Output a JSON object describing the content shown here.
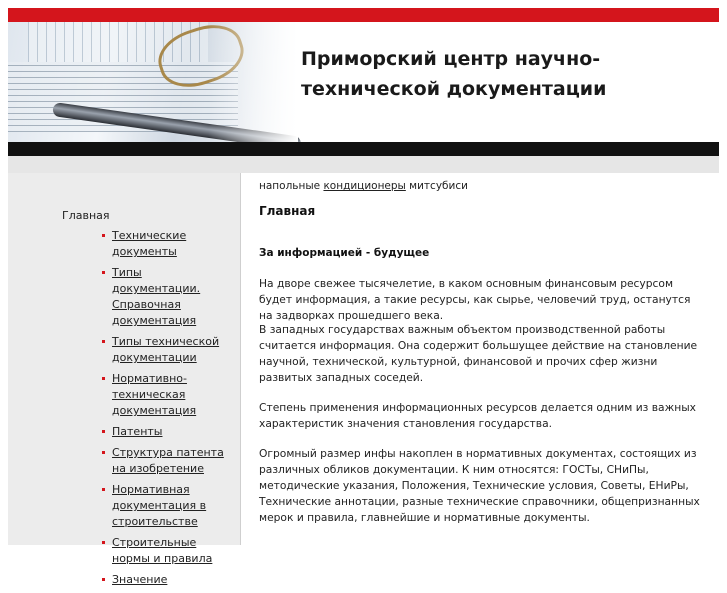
{
  "header": {
    "title_line1": "Приморский центр научно-",
    "title_line2": "технической документации"
  },
  "colors": {
    "accent": "#d4151c",
    "dark_bar": "#111111",
    "sidebar_bg": "#ececec"
  },
  "sidebar": {
    "home_label": "Главная",
    "items": [
      {
        "label": "Технические документы"
      },
      {
        "label": "Типы документации. Справочная документация"
      },
      {
        "label": "Типы технической документации"
      },
      {
        "label": "Нормативно-техническая документация"
      },
      {
        "label": "Патенты"
      },
      {
        "label": "Структура патента на изобретение"
      },
      {
        "label": "Нормативная документация в строительстве"
      },
      {
        "label": "Строительные нормы и правила"
      },
      {
        "label": "Значение"
      }
    ]
  },
  "content": {
    "ad_prefix": "напольные ",
    "ad_link": "кондиционеры",
    "ad_suffix": " митсубиси",
    "page_heading": "Главная",
    "section_heading": "За информацией - будущее",
    "paragraphs": [
      "На дворе свежее тысячелетие, в каком основным финансовым ресурсом будет информация, а такие ресурсы, как сырье, человечий труд, останутся на задворках прошедшего века.",
      "В западных государствах    важным объектом производственной работы считается информация. Она     содержит большущее действие на становление научной, технической, культурной, финансовой и прочих сфер жизни развитых        западных соседей.",
      "Степень применения информационных ресурсов делается одним из важных характеристик значения становления государства.",
      "Огромный размер инфы накоплен в нормативных документах, состоящих из различных обликов документации. К ним относятся: ГОСТы, СНиПы, методические указания, Положения, Технические условия, Советы, ЕНиРы, Технические аннотации, разные технические справочники, общепризнанных мерок и правила, главнейшие и нормативные документы."
    ]
  }
}
